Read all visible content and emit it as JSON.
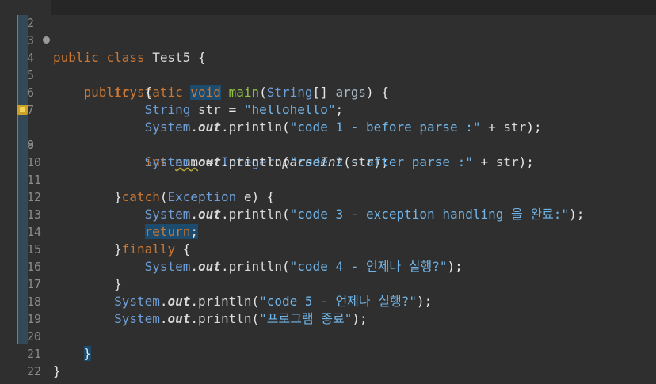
{
  "editor": {
    "top_line_number": "2",
    "lines": [
      {
        "n": "3"
      },
      {
        "n": "4"
      },
      {
        "n": "5"
      },
      {
        "n": "6"
      },
      {
        "n": "7"
      },
      {
        "n": "8"
      },
      {
        "n": "9"
      },
      {
        "n": "10"
      },
      {
        "n": "11"
      },
      {
        "n": "12"
      },
      {
        "n": "13"
      },
      {
        "n": "14"
      },
      {
        "n": "15"
      },
      {
        "n": "16"
      },
      {
        "n": "17"
      },
      {
        "n": "18"
      },
      {
        "n": "19"
      },
      {
        "n": "20"
      },
      {
        "n": "21"
      },
      {
        "n": "22"
      }
    ],
    "tokens": {
      "l3": {
        "public": "public",
        "class": "class",
        "name": "Test5",
        "brace": "{"
      },
      "l4": {
        "public": "public",
        "static": "static",
        "void": "void",
        "main": "main",
        "open": "(",
        "String": "String",
        "arr": "[]",
        "args": "args",
        "close": ")",
        "brace": "{"
      },
      "l5": {
        "try": "try",
        "brace": "{"
      },
      "l6": {
        "String": "String",
        "str": "str",
        "eq": "=",
        "literal": "\"hellohello\"",
        "semi": ";"
      },
      "l7": {
        "System": "System",
        "dot1": ".",
        "out": "out",
        "dot2": ".",
        "println": "println",
        "open": "(",
        "literal": "\"code 1 - before parse :\"",
        "plus": "+",
        "str": "str",
        "close": ");"
      },
      "l8": {
        "int": "int",
        "num": "num",
        "eq": "=",
        "Integer": "Integer",
        "dot": ".",
        "parseInt": "parseInt",
        "open": "(",
        "str": "str",
        "close": ");"
      },
      "l9": {
        "System": "System",
        "dot1": ".",
        "out": "out",
        "dot2": ".",
        "println": "println",
        "open": "(",
        "literal": "\"code 2 - after parse :\"",
        "plus": "+",
        "str": "str",
        "close": ");"
      },
      "l11": {
        "close": "}",
        "catch": "catch",
        "open": "(",
        "Exception": "Exception",
        "e": "e",
        "close2": ")",
        "brace": "{"
      },
      "l12": {
        "System": "System",
        "dot1": ".",
        "out": "out",
        "dot2": ".",
        "println": "println",
        "open": "(",
        "literal": "\"code 3 - exception handling 을 완료:\"",
        "close": ");"
      },
      "l13": {
        "return": "return",
        "semi": ";"
      },
      "l14": {
        "close": "}",
        "finally": "finally",
        "brace": "{"
      },
      "l15": {
        "System": "System",
        "dot1": ".",
        "out": "out",
        "dot2": ".",
        "println": "println",
        "open": "(",
        "literal": "\"code 4 - 언제나 실행?\"",
        "close": ");"
      },
      "l16": {
        "close": "}"
      },
      "l17": {
        "System": "System",
        "dot1": ".",
        "out": "out",
        "dot2": ".",
        "println": "println",
        "open": "(",
        "literal": "\"code 5 - 언제나 실행?\"",
        "close": ");"
      },
      "l18": {
        "System": "System",
        "dot1": ".",
        "out": "out",
        "dot2": ".",
        "println": "println",
        "open": "(",
        "literal": "\"프로그램 종료\"",
        "close": ");"
      },
      "l20": {
        "close": "}"
      },
      "l21": {
        "close": "}"
      }
    }
  },
  "colors": {
    "background": "#2f2f2f",
    "keyword": "#cc7832",
    "type": "#6f9fd8",
    "string": "#71b5e8",
    "method": "#8fc33f",
    "selection": "#1d4b6e",
    "line_number": "#8b8b8b"
  },
  "icons": {
    "fold": "fold-collapse-icon",
    "warning": "warning-marker-icon"
  }
}
